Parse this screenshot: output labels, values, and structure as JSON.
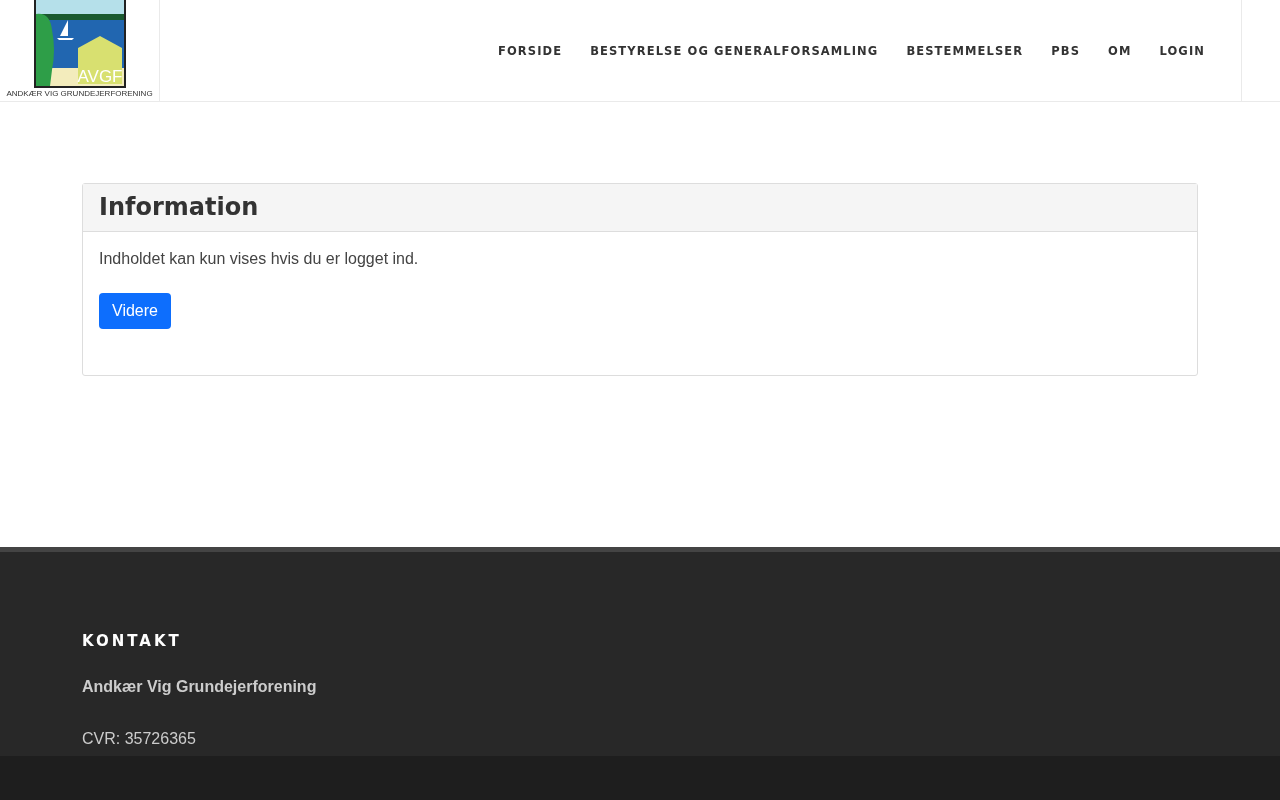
{
  "logo": {
    "initials": "AVGF",
    "caption": "ANDKÆR VIG GRUNDEJERFORENING"
  },
  "nav": [
    {
      "label": "FORSIDE"
    },
    {
      "label": "BESTYRELSE OG GENERALFORSAMLING"
    },
    {
      "label": "BESTEMMELSER"
    },
    {
      "label": "PBS"
    },
    {
      "label": "OM"
    },
    {
      "label": "LOGIN"
    }
  ],
  "panel": {
    "title": "Information",
    "message": "Indholdet kan kun vises hvis du er logget ind.",
    "button": "Videre"
  },
  "footer": {
    "heading": "KONTAKT",
    "organization": "Andkær Vig Grundejerforening",
    "cvr": "CVR: 35726365"
  }
}
